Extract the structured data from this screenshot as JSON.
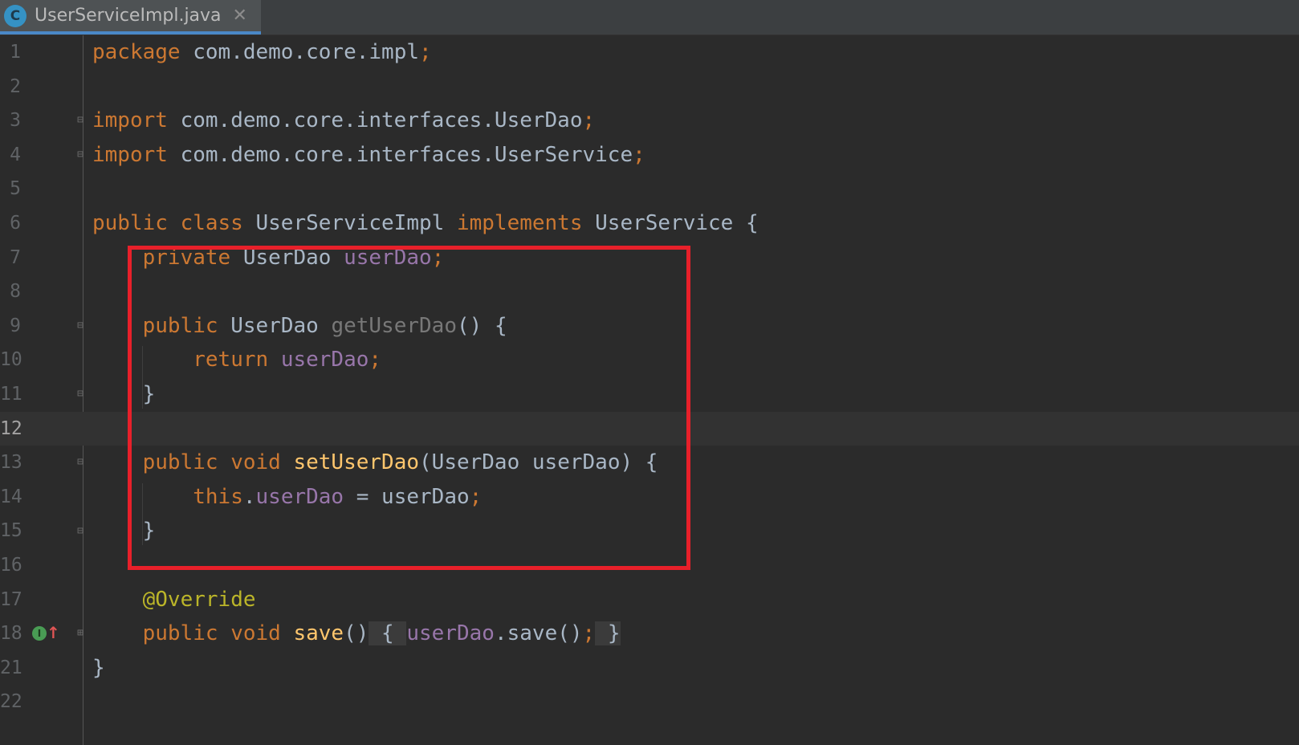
{
  "tab": {
    "icon_letter": "C",
    "label": "UserServiceImpl.java",
    "close_glyph": "✕"
  },
  "lines": [
    {
      "num": "1",
      "code": [
        [
          "kw",
          "package "
        ],
        [
          "txt",
          "com.demo.core.impl"
        ],
        [
          "kw",
          ";"
        ]
      ]
    },
    {
      "num": "2",
      "code": []
    },
    {
      "num": "3",
      "code": [
        [
          "kw",
          "import "
        ],
        [
          "txt",
          "com.demo.core.interfaces.UserDao"
        ],
        [
          "kw",
          ";"
        ]
      ]
    },
    {
      "num": "4",
      "code": [
        [
          "kw",
          "import "
        ],
        [
          "txt",
          "com.demo.core.interfaces.UserService"
        ],
        [
          "kw",
          ";"
        ]
      ]
    },
    {
      "num": "5",
      "code": []
    },
    {
      "num": "6",
      "code": [
        [
          "kw",
          "public class "
        ],
        [
          "txt",
          "UserServiceImpl "
        ],
        [
          "kw",
          "implements "
        ],
        [
          "txt",
          "UserService {"
        ]
      ]
    },
    {
      "num": "7",
      "code": [
        [
          "txt",
          "    "
        ],
        [
          "kw",
          "private "
        ],
        [
          "txt",
          "UserDao "
        ],
        [
          "fld",
          "userDao"
        ],
        [
          "kw",
          ";"
        ]
      ]
    },
    {
      "num": "8",
      "code": []
    },
    {
      "num": "9",
      "code": [
        [
          "txt",
          "    "
        ],
        [
          "kw",
          "public "
        ],
        [
          "txt",
          "UserDao "
        ],
        [
          "gray",
          "getUserDao"
        ],
        [
          "txt",
          "() {"
        ]
      ]
    },
    {
      "num": "10",
      "code": [
        [
          "txt",
          "        "
        ],
        [
          "kw",
          "return "
        ],
        [
          "fld",
          "userDao"
        ],
        [
          "kw",
          ";"
        ]
      ]
    },
    {
      "num": "11",
      "code": [
        [
          "txt",
          "    }"
        ]
      ]
    },
    {
      "num": "12",
      "code": [],
      "current": true
    },
    {
      "num": "13",
      "code": [
        [
          "txt",
          "    "
        ],
        [
          "kw",
          "public void "
        ],
        [
          "fn",
          "setUserDao"
        ],
        [
          "txt",
          "(UserDao userDao) {"
        ]
      ]
    },
    {
      "num": "14",
      "code": [
        [
          "txt",
          "        "
        ],
        [
          "kw",
          "this"
        ],
        [
          "txt",
          "."
        ],
        [
          "fld",
          "userDao"
        ],
        [
          "txt",
          " = userDao"
        ],
        [
          "kw",
          ";"
        ]
      ]
    },
    {
      "num": "15",
      "code": [
        [
          "txt",
          "    }"
        ]
      ]
    },
    {
      "num": "16",
      "code": []
    },
    {
      "num": "17",
      "code": [
        [
          "txt",
          "    "
        ],
        [
          "ann",
          "@Override"
        ]
      ]
    },
    {
      "num": "18",
      "code": [
        [
          "txt",
          "    "
        ],
        [
          "kw",
          "public void "
        ],
        [
          "fn",
          "save"
        ],
        [
          "txt",
          "()"
        ],
        [
          "foldbg",
          " { "
        ],
        [
          "fld",
          "userDao"
        ],
        [
          "txt",
          ".save()"
        ],
        [
          "kw",
          ";"
        ],
        [
          "foldbg",
          " }"
        ]
      ]
    },
    {
      "num": "21",
      "code": [
        [
          "txt",
          "}"
        ]
      ]
    },
    {
      "num": "22",
      "code": []
    }
  ],
  "fold_markers": {
    "3": "⊟",
    "4": "⊟",
    "9": "⊟",
    "11": "⊟",
    "13": "⊟",
    "15": "⊟",
    "18": "⊞"
  },
  "gutter_icons": {
    "implements_marker_line": "18",
    "implements_icon_letter": "I",
    "implements_arrow": "↑"
  },
  "colors": {
    "background": "#2b2b2b",
    "keyword": "#cc7832",
    "field": "#9876aa",
    "method": "#ffc66d",
    "annotation": "#bbb529",
    "highlight_box": "#e8202a"
  }
}
